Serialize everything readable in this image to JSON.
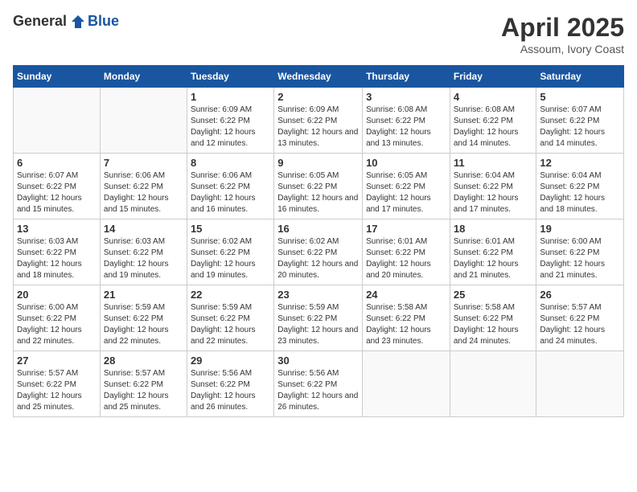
{
  "header": {
    "logo_general": "General",
    "logo_blue": "Blue",
    "month_title": "April 2025",
    "location": "Assoum, Ivory Coast"
  },
  "days_of_week": [
    "Sunday",
    "Monday",
    "Tuesday",
    "Wednesday",
    "Thursday",
    "Friday",
    "Saturday"
  ],
  "weeks": [
    [
      {
        "day": "",
        "sunrise": "",
        "sunset": "",
        "daylight": ""
      },
      {
        "day": "",
        "sunrise": "",
        "sunset": "",
        "daylight": ""
      },
      {
        "day": "1",
        "sunrise": "Sunrise: 6:09 AM",
        "sunset": "Sunset: 6:22 PM",
        "daylight": "Daylight: 12 hours and 12 minutes."
      },
      {
        "day": "2",
        "sunrise": "Sunrise: 6:09 AM",
        "sunset": "Sunset: 6:22 PM",
        "daylight": "Daylight: 12 hours and 13 minutes."
      },
      {
        "day": "3",
        "sunrise": "Sunrise: 6:08 AM",
        "sunset": "Sunset: 6:22 PM",
        "daylight": "Daylight: 12 hours and 13 minutes."
      },
      {
        "day": "4",
        "sunrise": "Sunrise: 6:08 AM",
        "sunset": "Sunset: 6:22 PM",
        "daylight": "Daylight: 12 hours and 14 minutes."
      },
      {
        "day": "5",
        "sunrise": "Sunrise: 6:07 AM",
        "sunset": "Sunset: 6:22 PM",
        "daylight": "Daylight: 12 hours and 14 minutes."
      }
    ],
    [
      {
        "day": "6",
        "sunrise": "Sunrise: 6:07 AM",
        "sunset": "Sunset: 6:22 PM",
        "daylight": "Daylight: 12 hours and 15 minutes."
      },
      {
        "day": "7",
        "sunrise": "Sunrise: 6:06 AM",
        "sunset": "Sunset: 6:22 PM",
        "daylight": "Daylight: 12 hours and 15 minutes."
      },
      {
        "day": "8",
        "sunrise": "Sunrise: 6:06 AM",
        "sunset": "Sunset: 6:22 PM",
        "daylight": "Daylight: 12 hours and 16 minutes."
      },
      {
        "day": "9",
        "sunrise": "Sunrise: 6:05 AM",
        "sunset": "Sunset: 6:22 PM",
        "daylight": "Daylight: 12 hours and 16 minutes."
      },
      {
        "day": "10",
        "sunrise": "Sunrise: 6:05 AM",
        "sunset": "Sunset: 6:22 PM",
        "daylight": "Daylight: 12 hours and 17 minutes."
      },
      {
        "day": "11",
        "sunrise": "Sunrise: 6:04 AM",
        "sunset": "Sunset: 6:22 PM",
        "daylight": "Daylight: 12 hours and 17 minutes."
      },
      {
        "day": "12",
        "sunrise": "Sunrise: 6:04 AM",
        "sunset": "Sunset: 6:22 PM",
        "daylight": "Daylight: 12 hours and 18 minutes."
      }
    ],
    [
      {
        "day": "13",
        "sunrise": "Sunrise: 6:03 AM",
        "sunset": "Sunset: 6:22 PM",
        "daylight": "Daylight: 12 hours and 18 minutes."
      },
      {
        "day": "14",
        "sunrise": "Sunrise: 6:03 AM",
        "sunset": "Sunset: 6:22 PM",
        "daylight": "Daylight: 12 hours and 19 minutes."
      },
      {
        "day": "15",
        "sunrise": "Sunrise: 6:02 AM",
        "sunset": "Sunset: 6:22 PM",
        "daylight": "Daylight: 12 hours and 19 minutes."
      },
      {
        "day": "16",
        "sunrise": "Sunrise: 6:02 AM",
        "sunset": "Sunset: 6:22 PM",
        "daylight": "Daylight: 12 hours and 20 minutes."
      },
      {
        "day": "17",
        "sunrise": "Sunrise: 6:01 AM",
        "sunset": "Sunset: 6:22 PM",
        "daylight": "Daylight: 12 hours and 20 minutes."
      },
      {
        "day": "18",
        "sunrise": "Sunrise: 6:01 AM",
        "sunset": "Sunset: 6:22 PM",
        "daylight": "Daylight: 12 hours and 21 minutes."
      },
      {
        "day": "19",
        "sunrise": "Sunrise: 6:00 AM",
        "sunset": "Sunset: 6:22 PM",
        "daylight": "Daylight: 12 hours and 21 minutes."
      }
    ],
    [
      {
        "day": "20",
        "sunrise": "Sunrise: 6:00 AM",
        "sunset": "Sunset: 6:22 PM",
        "daylight": "Daylight: 12 hours and 22 minutes."
      },
      {
        "day": "21",
        "sunrise": "Sunrise: 5:59 AM",
        "sunset": "Sunset: 6:22 PM",
        "daylight": "Daylight: 12 hours and 22 minutes."
      },
      {
        "day": "22",
        "sunrise": "Sunrise: 5:59 AM",
        "sunset": "Sunset: 6:22 PM",
        "daylight": "Daylight: 12 hours and 22 minutes."
      },
      {
        "day": "23",
        "sunrise": "Sunrise: 5:59 AM",
        "sunset": "Sunset: 6:22 PM",
        "daylight": "Daylight: 12 hours and 23 minutes."
      },
      {
        "day": "24",
        "sunrise": "Sunrise: 5:58 AM",
        "sunset": "Sunset: 6:22 PM",
        "daylight": "Daylight: 12 hours and 23 minutes."
      },
      {
        "day": "25",
        "sunrise": "Sunrise: 5:58 AM",
        "sunset": "Sunset: 6:22 PM",
        "daylight": "Daylight: 12 hours and 24 minutes."
      },
      {
        "day": "26",
        "sunrise": "Sunrise: 5:57 AM",
        "sunset": "Sunset: 6:22 PM",
        "daylight": "Daylight: 12 hours and 24 minutes."
      }
    ],
    [
      {
        "day": "27",
        "sunrise": "Sunrise: 5:57 AM",
        "sunset": "Sunset: 6:22 PM",
        "daylight": "Daylight: 12 hours and 25 minutes."
      },
      {
        "day": "28",
        "sunrise": "Sunrise: 5:57 AM",
        "sunset": "Sunset: 6:22 PM",
        "daylight": "Daylight: 12 hours and 25 minutes."
      },
      {
        "day": "29",
        "sunrise": "Sunrise: 5:56 AM",
        "sunset": "Sunset: 6:22 PM",
        "daylight": "Daylight: 12 hours and 26 minutes."
      },
      {
        "day": "30",
        "sunrise": "Sunrise: 5:56 AM",
        "sunset": "Sunset: 6:22 PM",
        "daylight": "Daylight: 12 hours and 26 minutes."
      },
      {
        "day": "",
        "sunrise": "",
        "sunset": "",
        "daylight": ""
      },
      {
        "day": "",
        "sunrise": "",
        "sunset": "",
        "daylight": ""
      },
      {
        "day": "",
        "sunrise": "",
        "sunset": "",
        "daylight": ""
      }
    ]
  ]
}
